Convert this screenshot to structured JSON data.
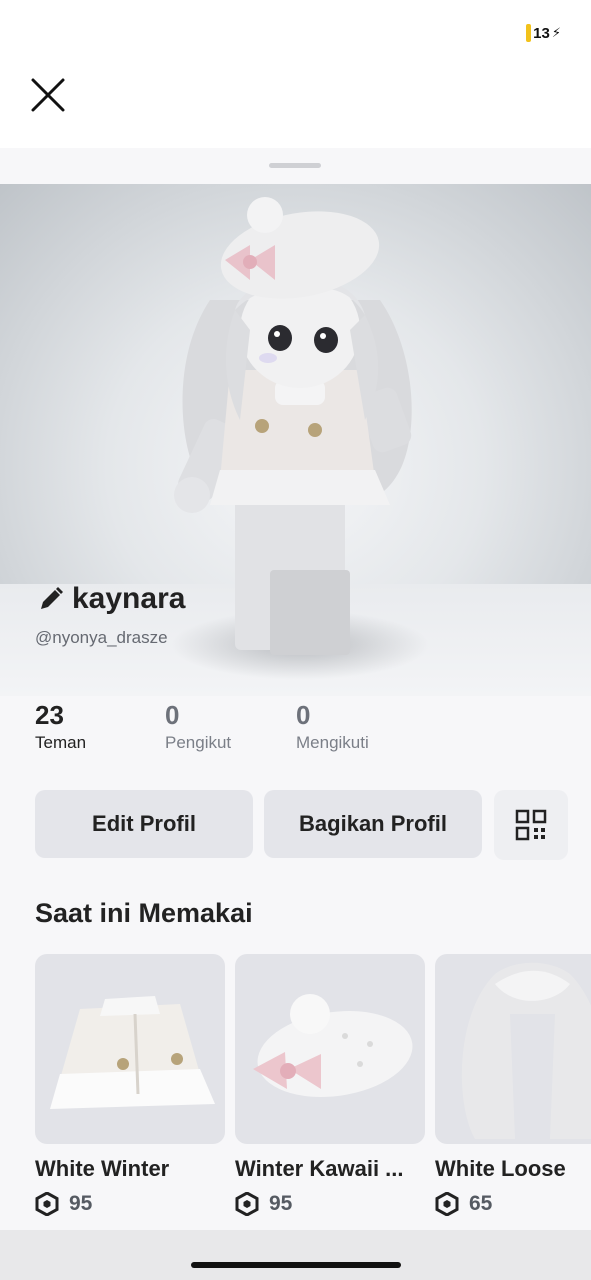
{
  "status_bar": {
    "battery": "13"
  },
  "profile": {
    "display_name": "kaynara",
    "username": "@nyonya_drasze"
  },
  "stats": [
    {
      "value": "23",
      "label": "Teman"
    },
    {
      "value": "0",
      "label": "Pengikut"
    },
    {
      "value": "0",
      "label": "Mengikuti"
    }
  ],
  "actions": {
    "edit": "Edit Profil",
    "share": "Bagikan Profil"
  },
  "wearing": {
    "title": "Saat ini Memakai",
    "items": [
      {
        "name": "White Winter",
        "price": "95"
      },
      {
        "name": "Winter Kawaii ...",
        "price": "95"
      },
      {
        "name": "White Loose",
        "price": "65"
      }
    ]
  },
  "icons": {
    "close": "close-icon",
    "pencil": "pencil-icon",
    "qr": "qr-code-icon",
    "currency": "robux-icon"
  },
  "colors": {
    "battery": "#f2c21b",
    "button_bg": "#e4e5ea",
    "text_primary": "#222222",
    "text_muted": "#6d717a"
  }
}
